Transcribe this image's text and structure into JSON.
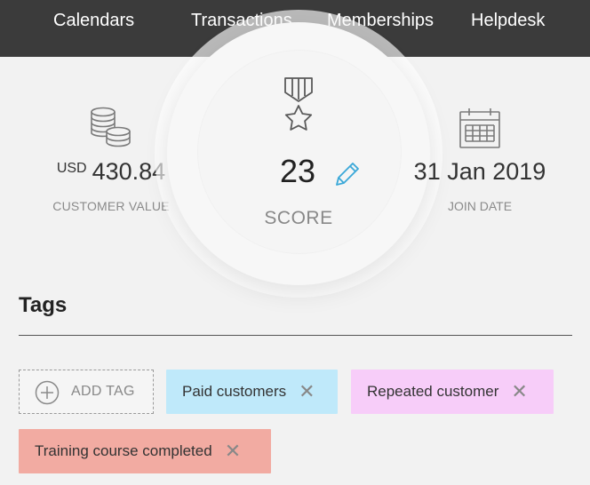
{
  "nav": {
    "items": [
      {
        "label": "Calendars"
      },
      {
        "label": "Transactions"
      },
      {
        "label": "Memberships"
      },
      {
        "label": "Helpdesk"
      }
    ]
  },
  "stats": {
    "customer_value": {
      "currency": "USD",
      "amount": "430.84",
      "label": "CUSTOMER VALUE",
      "icon": "coins-stack-icon"
    },
    "score": {
      "value": "23",
      "label": "SCORE",
      "icon": "medal-star-icon",
      "edit_icon": "pencil-icon"
    },
    "join_date": {
      "value": "31 Jan 2019",
      "label": "JOIN DATE",
      "icon": "calendar-icon"
    }
  },
  "tags": {
    "heading": "Tags",
    "add_label": "ADD TAG",
    "items": [
      {
        "label": "Paid customers",
        "color": "#bfe9fa"
      },
      {
        "label": "Repeated customer",
        "color": "#f7cdf9"
      },
      {
        "label": "Training course completed",
        "color": "#f2aba2"
      }
    ]
  },
  "colors": {
    "nav_bg": "#3b3b3b",
    "page_bg": "#f2f2f2",
    "accent_edit": "#3aa8d8"
  }
}
